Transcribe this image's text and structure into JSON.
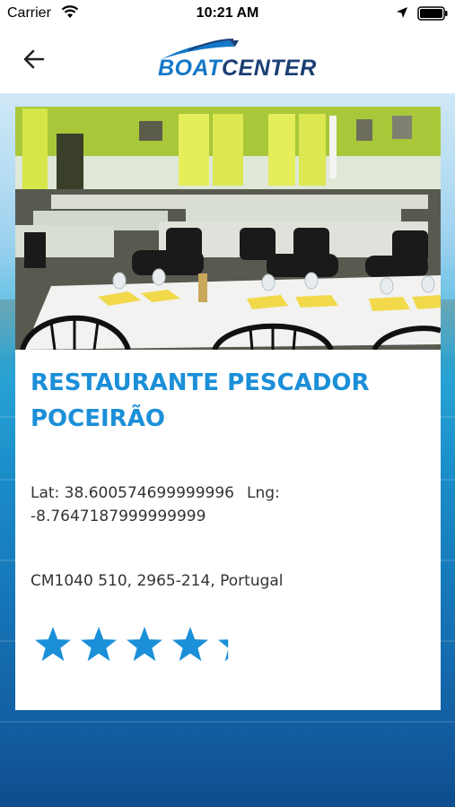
{
  "status_bar": {
    "carrier": "Carrier",
    "time": "10:21 AM",
    "icons": [
      "wifi-icon",
      "location-arrow-icon",
      "battery-icon"
    ]
  },
  "nav": {
    "back_icon": "arrow-left-icon",
    "logo": {
      "part1": "BOAT",
      "part2": "CENTER"
    }
  },
  "place": {
    "photo": "restaurant-dining-room",
    "name_line1": "RESTAURANTE PESCADOR",
    "name_line2": "POCEIRÃO",
    "lat_text": "Lat: 38.600574699999996",
    "lng_text": "Lng:",
    "lng_value": "-8.7647187999999999",
    "address": "CM1040 510, 2965-214, Portugal",
    "rating": 4.3,
    "rating_max": 5
  },
  "colors": {
    "accent": "#1b8fd8",
    "logo_dark": "#1b3f73",
    "logo_light": "#1478c8",
    "text": "#333333",
    "star": "#1b8fd8"
  }
}
